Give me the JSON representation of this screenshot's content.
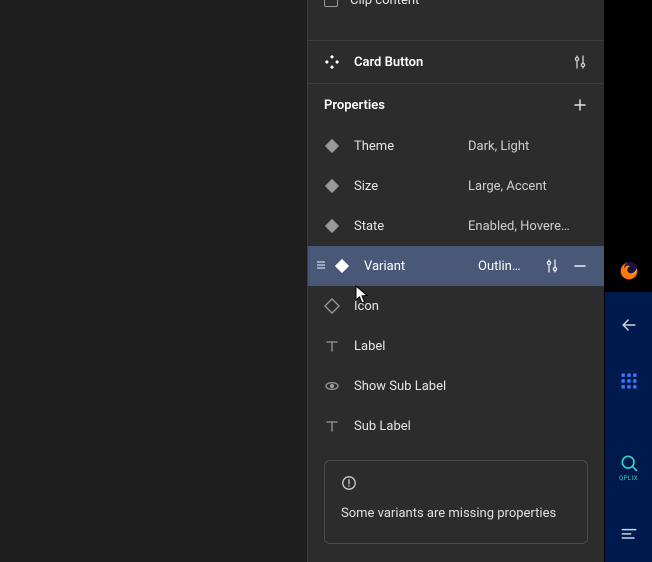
{
  "clip": {
    "label": "Clip content"
  },
  "component": {
    "name": "Card Button"
  },
  "props": {
    "title": "Properties",
    "items": [
      {
        "type": "variant",
        "name": "Theme",
        "values": "Dark, Light"
      },
      {
        "type": "variant",
        "name": "Size",
        "values": "Large, Accent"
      },
      {
        "type": "variant",
        "name": "State",
        "values": "Enabled, Hovere…"
      },
      {
        "type": "variant",
        "name": "Variant",
        "values": "Outlin…",
        "selected": true
      },
      {
        "type": "swap",
        "name": "Icon",
        "values": ""
      },
      {
        "type": "text",
        "name": "Label",
        "values": ""
      },
      {
        "type": "bool",
        "name": "Show Sub Label",
        "values": ""
      },
      {
        "type": "text",
        "name": "Sub Label",
        "values": ""
      }
    ]
  },
  "warning": {
    "message": "Some variants are missing properties"
  },
  "right_strip": {
    "brand": "QPLIX"
  }
}
